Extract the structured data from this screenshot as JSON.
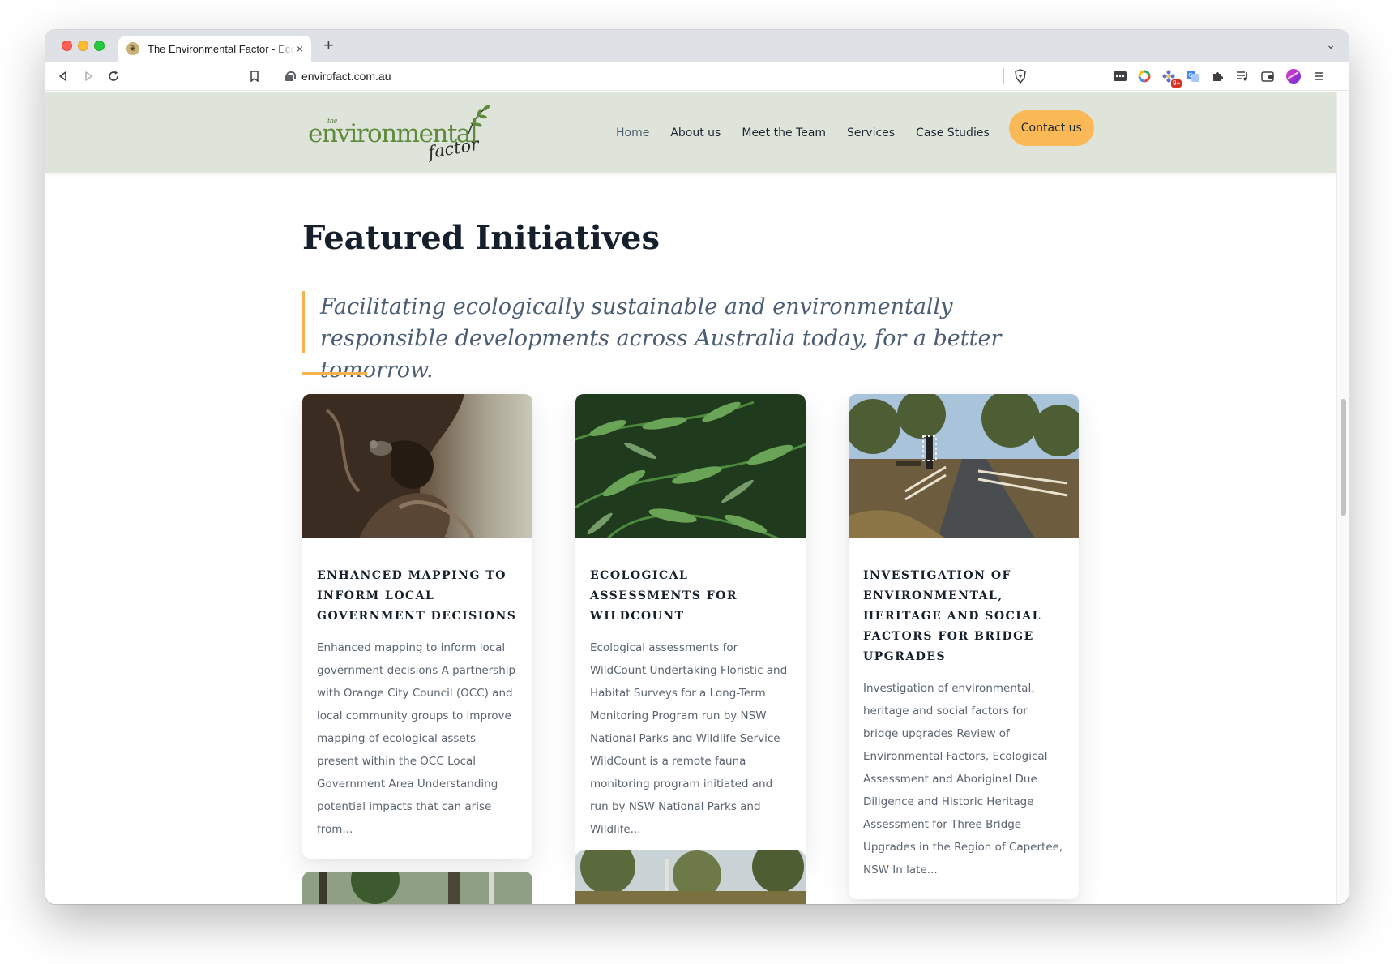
{
  "browser": {
    "tab_title": "The Environmental Factor - Eco",
    "tab_close": "×",
    "new_tab": "+",
    "tab_menu": "⌄",
    "url": "envirofact.com.au",
    "extension_badge": "9+"
  },
  "site": {
    "logo": {
      "small": "the",
      "main": "environmental",
      "script": "factor"
    },
    "nav": {
      "items": [
        "Home",
        "About us",
        "Meet the Team",
        "Services",
        "Case Studies"
      ],
      "active": "Home",
      "cta": "Contact us"
    },
    "colors": {
      "header_bg": "#dfe4da",
      "accent": "#f7b24f",
      "cta": "#fbb857",
      "heading": "#15202c",
      "quote": "#4a5d72"
    }
  },
  "main": {
    "title": "Featured Initiatives",
    "quote": "Facilitating ecologically sustainable and environmentally responsible developments across Australia today, for a better tomorrow.",
    "cards": [
      {
        "title": "Enhanced mapping to inform local government decisions",
        "text": "Enhanced mapping to inform local government decisions A partnership with Orange City Council (OCC) and local community groups to improve mapping of ecological assets present within the OCC Local Government Area  Understanding potential impacts that can arise from..."
      },
      {
        "title": "Ecological Assessments for WildCount",
        "text": "Ecological assessments for WildCount Undertaking Floristic and Habitat Surveys for a Long-Term Monitoring Program run by NSW National Parks and Wildlife Service WildCount is a remote fauna monitoring program initiated and run by NSW National Parks and Wildlife..."
      },
      {
        "title": "Investigation of environmental, heritage and social factors for bridge upgrades",
        "text": "Investigation of environmental, heritage and social factors for bridge upgrades Review of Environmental Factors, Ecological Assessment and Aboriginal Due Diligence and Historic Heritage Assessment for Three Bridge Upgrades in the Region of Capertee, NSW   In late..."
      }
    ]
  }
}
